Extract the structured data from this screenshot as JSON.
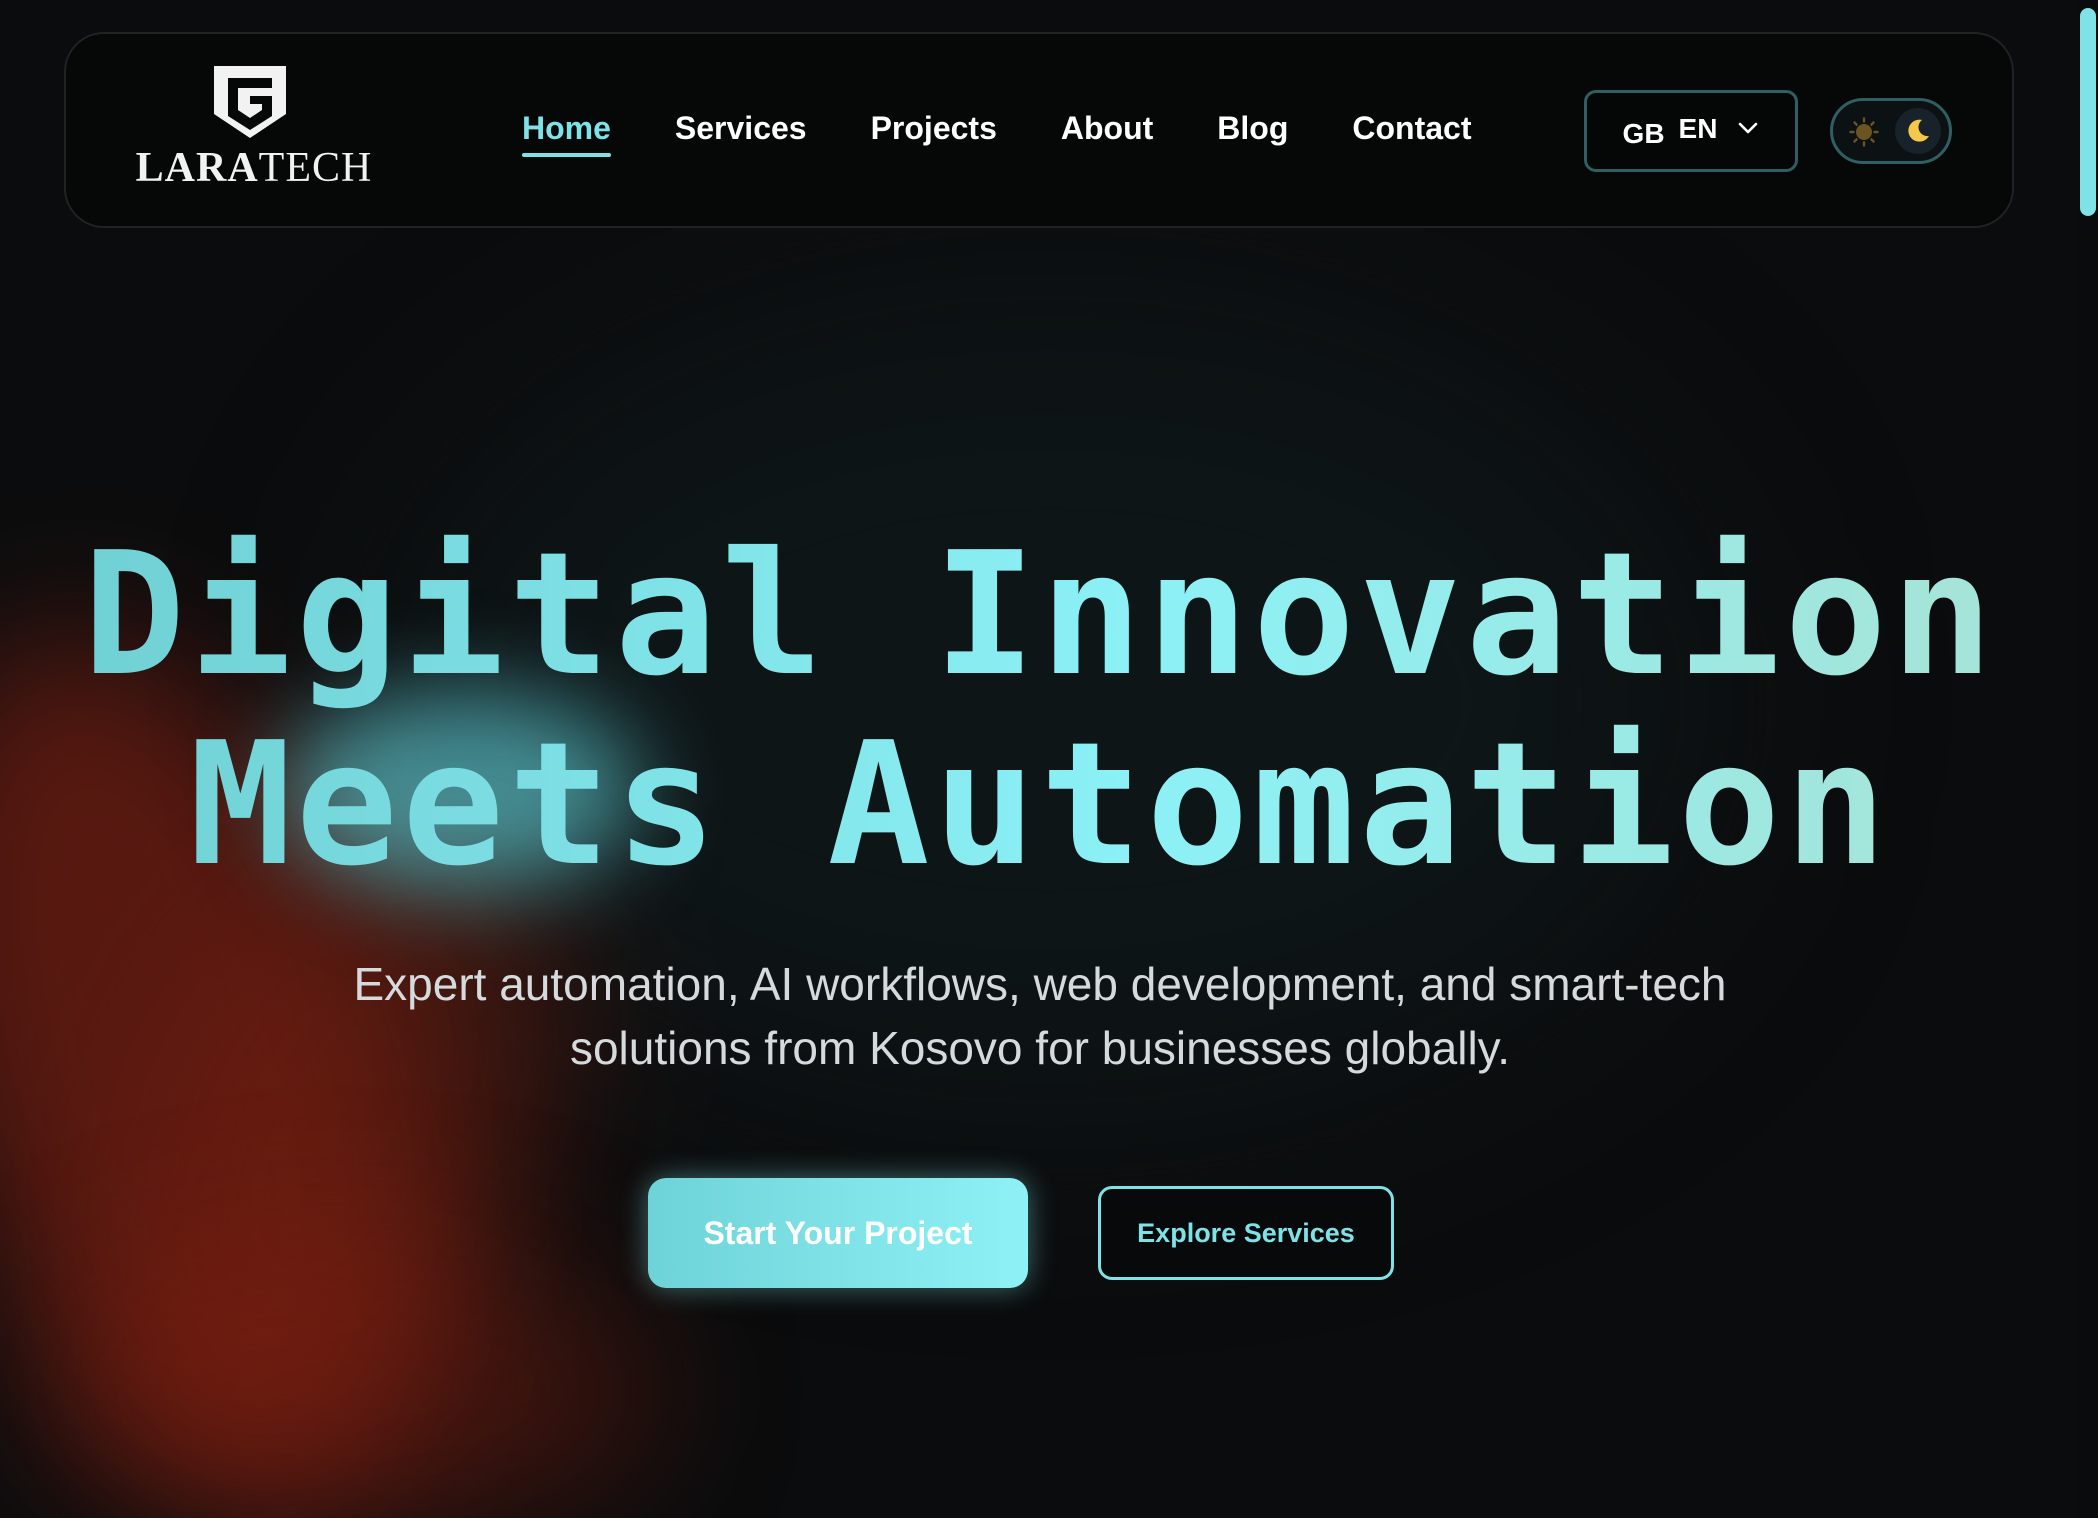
{
  "brand": {
    "name_bold": "LARA",
    "name_light": "TECH",
    "logo_icon": "shield-g-icon"
  },
  "nav": {
    "items": [
      {
        "label": "Home",
        "active": true
      },
      {
        "label": "Services",
        "active": false
      },
      {
        "label": "Projects",
        "active": false
      },
      {
        "label": "About",
        "active": false
      },
      {
        "label": "Blog",
        "active": false
      },
      {
        "label": "Contact",
        "active": false
      }
    ]
  },
  "language": {
    "flag": "GB",
    "code": "EN",
    "icon": "chevron-down-icon"
  },
  "theme_toggle": {
    "mode": "dark",
    "icons": [
      "sun-icon",
      "moon-icon"
    ]
  },
  "hero": {
    "title_line1": "Digital Innovation",
    "title_line2": "Meets Automation",
    "subtitle_line1": "Expert automation, AI workflows, web development, and smart-tech",
    "subtitle_line2": "solutions from Kosovo for businesses globally.",
    "primary_cta": "Start Your Project",
    "secondary_cta": "Explore Services"
  },
  "colors": {
    "accent": "#7ee2e6",
    "background": "#0b0c0d",
    "text": "#ffffff",
    "glow_red": "#96230f"
  }
}
